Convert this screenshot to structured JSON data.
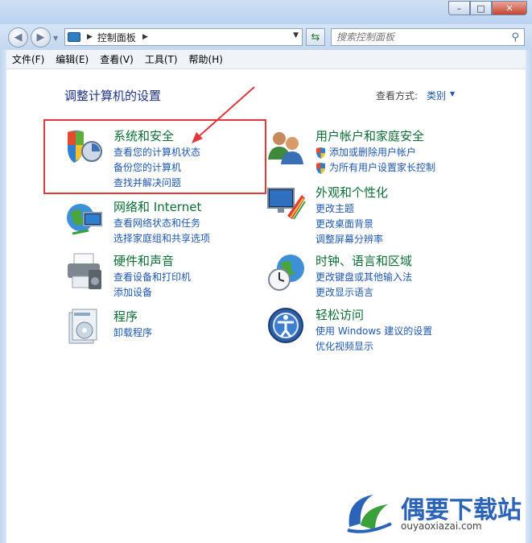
{
  "window": {
    "controls": {
      "minimize": "–",
      "maximize": "□",
      "close": "✕"
    }
  },
  "nav": {
    "address": "控制面板",
    "search_placeholder": "搜索控制面板"
  },
  "menu": [
    "文件(F)",
    "编辑(E)",
    "查看(V)",
    "工具(T)",
    "帮助(H)"
  ],
  "main": {
    "title": "调整计算机的设置",
    "view_label": "查看方式:",
    "view_value": "类别"
  },
  "categories": [
    {
      "heading": "系统和安全",
      "links": [
        "查看您的计算机状态",
        "备份您的计算机",
        "查找并解决问题"
      ],
      "icon": "shield-icon"
    },
    {
      "heading": "网络和 Internet",
      "links": [
        "查看网络状态和任务",
        "选择家庭组和共享选项"
      ],
      "icon": "globe-network-icon"
    },
    {
      "heading": "硬件和声音",
      "links": [
        "查看设备和打印机",
        "添加设备"
      ],
      "icon": "printer-icon"
    },
    {
      "heading": "程序",
      "links": [
        "卸载程序"
      ],
      "icon": "programs-icon"
    },
    {
      "heading": "用户帐户和家庭安全",
      "links": [
        "添加或删除用户帐户",
        "为所有用户设置家长控制"
      ],
      "icon": "users-icon"
    },
    {
      "heading": "外观和个性化",
      "links": [
        "更改主题",
        "更改桌面背景",
        "调整屏幕分辨率"
      ],
      "icon": "monitor-palette-icon"
    },
    {
      "heading": "时钟、语言和区域",
      "links": [
        "更改键盘或其他输入法",
        "更改显示语言"
      ],
      "icon": "clock-globe-icon"
    },
    {
      "heading": "轻松访问",
      "links": [
        "使用 Windows 建议的设置",
        "优化视频显示"
      ],
      "icon": "ease-of-access-icon"
    }
  ],
  "watermark": {
    "name": "偶要下载站",
    "url": "ouyaoxiazai.com"
  },
  "colors": {
    "heading_green": "#0c6e34",
    "link_blue": "#1e58b0",
    "highlight_red": "#e0393b"
  }
}
